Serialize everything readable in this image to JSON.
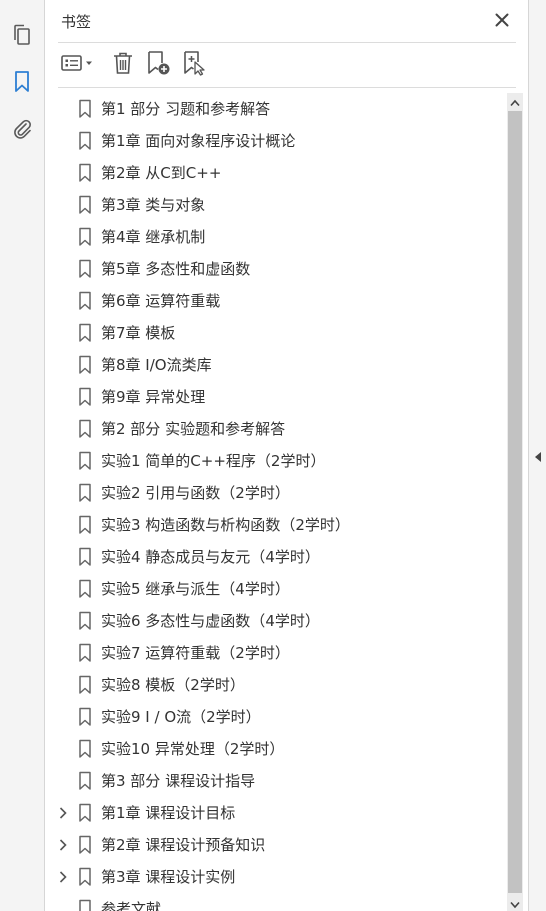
{
  "panel": {
    "title": "书签"
  },
  "rail": {
    "icons": [
      "pages-icon",
      "bookmark-icon",
      "attachment-icon"
    ]
  },
  "toolbar": {
    "buttons": [
      "options-menu-button",
      "delete-bookmark-button",
      "new-bookmark-button",
      "new-bookmark-from-structure-button"
    ]
  },
  "bookmarks": [
    {
      "label": "第1 部分 习题和参考解答",
      "expandable": false
    },
    {
      "label": "第1章 面向对象程序设计概论",
      "expandable": false
    },
    {
      "label": "第2章 从C到C++",
      "expandable": false
    },
    {
      "label": "第3章 类与对象",
      "expandable": false
    },
    {
      "label": "第4章 继承机制",
      "expandable": false
    },
    {
      "label": "第5章 多态性和虚函数",
      "expandable": false
    },
    {
      "label": "第6章 运算符重载",
      "expandable": false
    },
    {
      "label": "第7章 模板",
      "expandable": false
    },
    {
      "label": "第8章 I/O流类库",
      "expandable": false
    },
    {
      "label": "第9章 异常处理",
      "expandable": false
    },
    {
      "label": "第2 部分 实验题和参考解答",
      "expandable": false
    },
    {
      "label": "实验1 简单的C++程序（2学时）",
      "expandable": false
    },
    {
      "label": "实验2 引用与函数（2学时）",
      "expandable": false
    },
    {
      "label": "实验3 构造函数与析构函数（2学时）",
      "expandable": false
    },
    {
      "label": "实验4 静态成员与友元（4学时）",
      "expandable": false
    },
    {
      "label": "实验5 继承与派生（4学时）",
      "expandable": false
    },
    {
      "label": "实验6 多态性与虚函数（4学时）",
      "expandable": false
    },
    {
      "label": "实验7 运算符重载（2学时）",
      "expandable": false
    },
    {
      "label": "实验8 模板（2学时）",
      "expandable": false
    },
    {
      "label": "实验9 I / O流（2学时）",
      "expandable": false
    },
    {
      "label": "实验10 异常处理（2学时）",
      "expandable": false
    },
    {
      "label": "第3 部分 课程设计指导",
      "expandable": false
    },
    {
      "label": "第1章 课程设计目标",
      "expandable": true
    },
    {
      "label": "第2章 课程设计预备知识",
      "expandable": true
    },
    {
      "label": "第3章 课程设计实例",
      "expandable": true
    },
    {
      "label": "参考文献",
      "expandable": false
    }
  ],
  "colors": {
    "accent": "#2d7fd3",
    "icon": "#5a5a5a",
    "rail_bg": "#f4f4f4"
  }
}
